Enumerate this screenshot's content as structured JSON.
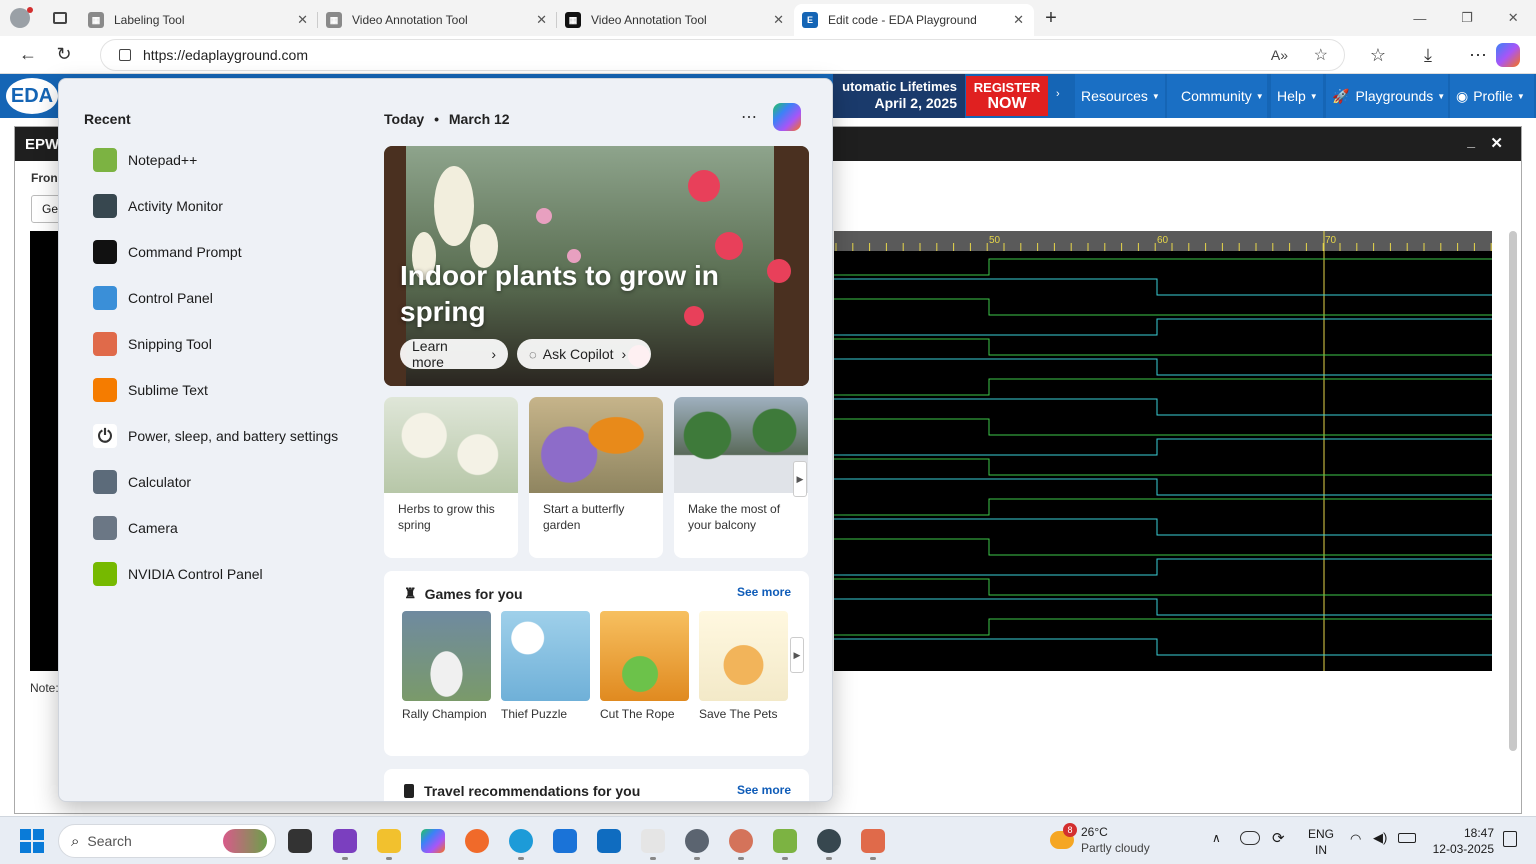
{
  "browser": {
    "tabs": [
      {
        "label": "Labeling Tool"
      },
      {
        "label": "Video Annotation Tool"
      },
      {
        "label": "Video Annotation Tool"
      },
      {
        "label": "Edit code - EDA Playground"
      }
    ],
    "url": "https://edaplayground.com",
    "new_tab": "+"
  },
  "site": {
    "logo": "EDA",
    "banner_line1": "utomatic Lifetimes",
    "banner_line2": "April 2, 2025",
    "register_line1": "REGISTER",
    "register_line2": "NOW",
    "nav": [
      "Resources",
      "Community",
      "Help",
      "Playgrounds",
      "Profile"
    ],
    "epwave_title": "EPW",
    "from_label": "Fron",
    "go_label": "Ge",
    "note_label": "Note:",
    "ruler_labels": [
      "50",
      "60",
      "70"
    ]
  },
  "startmenu": {
    "recent_heading": "Recent",
    "recent": [
      {
        "label": "Notepad++",
        "icon": "notepad-icon",
        "color": "#7cb342"
      },
      {
        "label": "Activity Monitor",
        "icon": "activity-monitor-icon",
        "color": "#37474f"
      },
      {
        "label": "Command Prompt",
        "icon": "terminal-icon",
        "color": "#111111"
      },
      {
        "label": "Control Panel",
        "icon": "control-panel-icon",
        "color": "#3a8fd8"
      },
      {
        "label": "Snipping Tool",
        "icon": "snipping-tool-icon",
        "color": "#e06a4a"
      },
      {
        "label": "Sublime Text",
        "icon": "sublime-icon",
        "color": "#f57c00"
      },
      {
        "label": "Power, sleep, and battery settings",
        "icon": "power-icon",
        "color": "#ffffff"
      },
      {
        "label": "Calculator",
        "icon": "calculator-icon",
        "color": "#5c6b7a"
      },
      {
        "label": "Camera",
        "icon": "camera-icon",
        "color": "#6b7785"
      },
      {
        "label": "NVIDIA Control Panel",
        "icon": "nvidia-icon",
        "color": "#76b900"
      }
    ],
    "date_today": "Today",
    "date_bullet": "•",
    "date_value": "March 12",
    "hero_title": "Indoor plants to grow in spring",
    "learn_more": "Learn more",
    "ask_copilot": "Ask Copilot",
    "cards": [
      {
        "caption": "Herbs to grow this spring"
      },
      {
        "caption": "Start a butterfly garden"
      },
      {
        "caption": "Make the most of your balcony"
      }
    ],
    "games_heading": "Games for you",
    "see_more": "See more",
    "games": [
      {
        "label": "Rally Champion",
        "color": "#7a9a6a"
      },
      {
        "label": "Thief Puzzle",
        "color": "#6fb0d8"
      },
      {
        "label": "Cut The Rope",
        "color": "#f0a030"
      },
      {
        "label": "Save The Pets",
        "color": "#f3e9c8"
      }
    ],
    "travel_heading": "Travel recommendations for you",
    "travel_see_more": "See more"
  },
  "taskbar": {
    "search_placeholder": "Search",
    "weather_badge": "8",
    "weather_temp": "26°C",
    "weather_desc": "Partly cloudy",
    "lang_line1": "ENG",
    "lang_line2": "IN",
    "time": "18:47",
    "date": "12-03-2025"
  }
}
